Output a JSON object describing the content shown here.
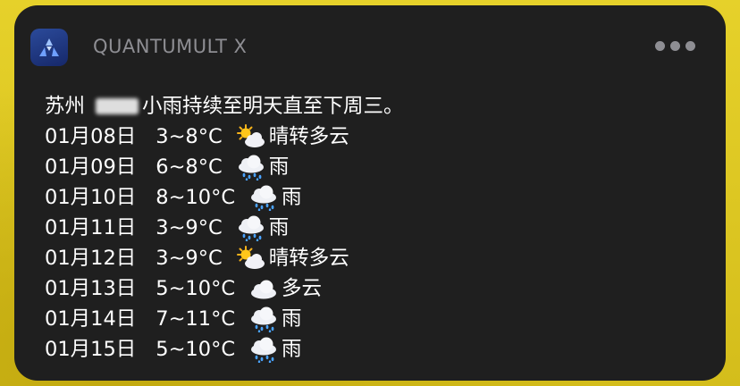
{
  "notification": {
    "app_name": "QUANTUMULT X",
    "headline_city": "苏州",
    "headline_text": "小雨持续至明天直至下周三。"
  },
  "forecast": [
    {
      "date": "01月08日",
      "temp": "3~8°C",
      "icon": "sun-cloud-icon",
      "desc": "晴转多云"
    },
    {
      "date": "01月09日",
      "temp": "6~8°C",
      "icon": "rain-cloud-icon",
      "desc": "雨"
    },
    {
      "date": "01月10日",
      "temp": "8~10°C",
      "icon": "rain-cloud-icon",
      "desc": "雨"
    },
    {
      "date": "01月11日",
      "temp": "3~9°C",
      "icon": "rain-cloud-icon",
      "desc": "雨"
    },
    {
      "date": "01月12日",
      "temp": "3~9°C",
      "icon": "sun-cloud-icon",
      "desc": "晴转多云"
    },
    {
      "date": "01月13日",
      "temp": "5~10°C",
      "icon": "cloud-icon",
      "desc": "多云"
    },
    {
      "date": "01月14日",
      "temp": "7~11°C",
      "icon": "rain-cloud-icon",
      "desc": "雨"
    },
    {
      "date": "01月15日",
      "temp": "5~10°C",
      "icon": "rain-cloud-icon",
      "desc": "雨"
    }
  ],
  "colors": {
    "background": "#d9c41f",
    "card": "#1f1f1f",
    "app_name": "#8e8e93",
    "text": "#ffffff"
  }
}
